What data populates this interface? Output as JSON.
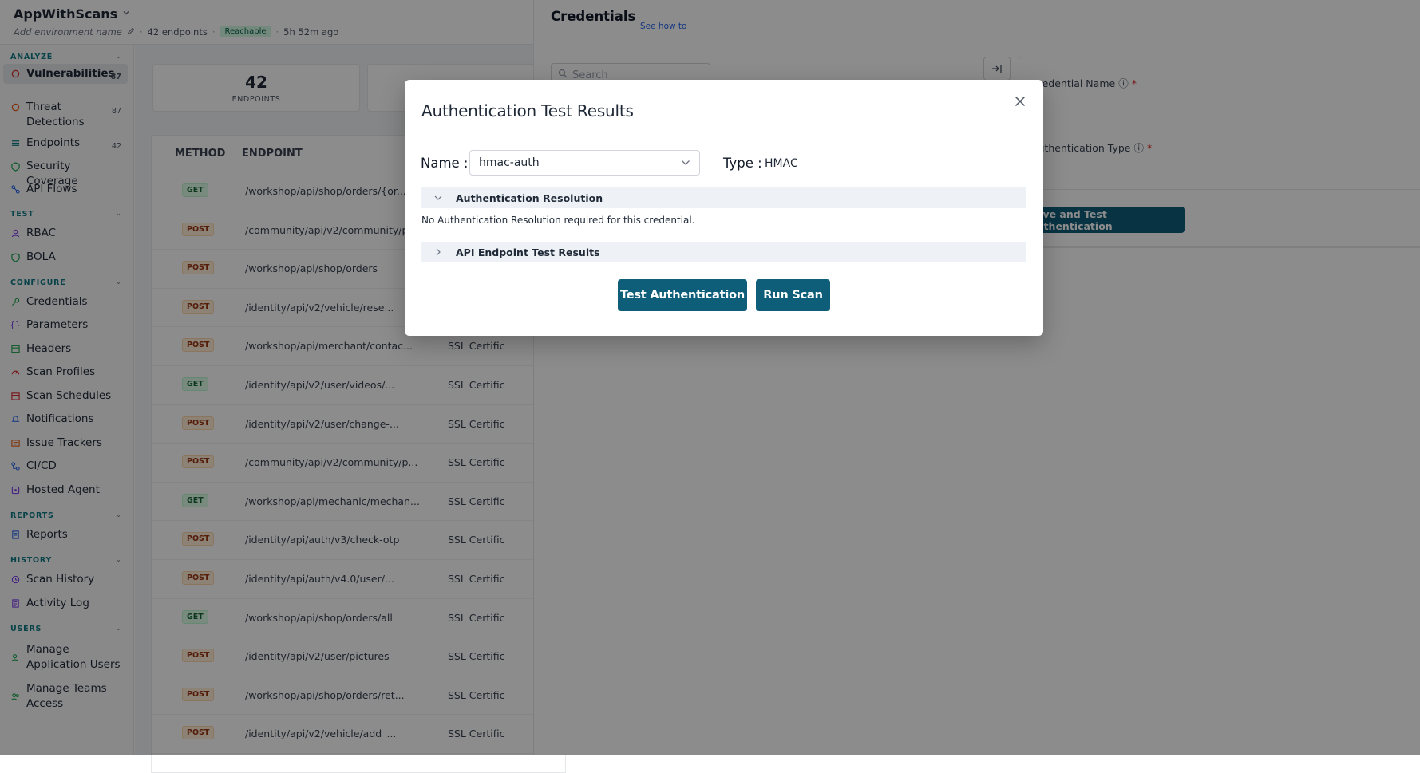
{
  "app": {
    "name": "AppWithScans",
    "env_placeholder": "Add environment name",
    "endpoint_count_text": "42 endpoints",
    "reachable_badge": "Reachable",
    "last_seen": "5h 52m ago"
  },
  "sidebar": {
    "sections": [
      {
        "title": "ANALYZE",
        "items": [
          {
            "label": "Vulnerabilities",
            "count": "87",
            "icon": "shield-alert-icon",
            "active": true
          },
          {
            "label": "Threat Detections",
            "count": "87",
            "icon": "threat-icon"
          },
          {
            "label": "Endpoints",
            "count": "42",
            "icon": "endpoints-icon"
          },
          {
            "label": "Security Coverage",
            "icon": "coverage-icon"
          },
          {
            "label": "API Flows",
            "icon": "flows-icon"
          }
        ]
      },
      {
        "title": "TEST",
        "items": [
          {
            "label": "RBAC",
            "icon": "rbac-icon"
          },
          {
            "label": "BOLA",
            "icon": "bola-icon"
          }
        ]
      },
      {
        "title": "CONFIGURE",
        "items": [
          {
            "label": "Credentials",
            "icon": "key-icon"
          },
          {
            "label": "Parameters",
            "icon": "braces-icon"
          },
          {
            "label": "Headers",
            "icon": "headers-icon"
          },
          {
            "label": "Scan Profiles",
            "icon": "gauge-icon"
          },
          {
            "label": "Scan Schedules",
            "icon": "calendar-icon"
          },
          {
            "label": "Notifications",
            "icon": "bell-icon"
          },
          {
            "label": "Issue Trackers",
            "icon": "tracker-icon"
          },
          {
            "label": "CI/CD",
            "icon": "cicd-icon"
          },
          {
            "label": "Hosted Agent",
            "icon": "agent-icon"
          }
        ]
      },
      {
        "title": "REPORTS",
        "items": [
          {
            "label": "Reports",
            "icon": "report-icon"
          }
        ]
      },
      {
        "title": "HISTORY",
        "items": [
          {
            "label": "Scan History",
            "icon": "history-icon"
          },
          {
            "label": "Activity Log",
            "icon": "log-icon"
          }
        ]
      },
      {
        "title": "USERS",
        "items": [
          {
            "label": "Manage Application Users",
            "icon": "users-icon"
          },
          {
            "label": "Manage Teams Access",
            "icon": "team-icon"
          }
        ]
      }
    ]
  },
  "stats": {
    "endpoints_value": "42",
    "endpoints_label": "ENDPOINTS"
  },
  "table": {
    "headers": {
      "method": "METHOD",
      "endpoint": "ENDPOINT"
    },
    "rows": [
      {
        "method": "GET",
        "endpoint": "/workshop/api/shop/orders/{or...",
        "vuln": ""
      },
      {
        "method": "POST",
        "endpoint": "/community/api/v2/community/p...",
        "vuln": ""
      },
      {
        "method": "POST",
        "endpoint": "/workshop/api/shop/orders",
        "vuln": ""
      },
      {
        "method": "POST",
        "endpoint": "/identity/api/v2/vehicle/rese...",
        "vuln": ""
      },
      {
        "method": "POST",
        "endpoint": "/workshop/api/merchant/contac...",
        "vuln": "SSL Certific"
      },
      {
        "method": "GET",
        "endpoint": "/identity/api/v2/user/videos/...",
        "vuln": "SSL Certific"
      },
      {
        "method": "POST",
        "endpoint": "/identity/api/v2/user/change-...",
        "vuln": "SSL Certific"
      },
      {
        "method": "POST",
        "endpoint": "/community/api/v2/community/p...",
        "vuln": "SSL Certific"
      },
      {
        "method": "GET",
        "endpoint": "/workshop/api/mechanic/mechan...",
        "vuln": "SSL Certific"
      },
      {
        "method": "POST",
        "endpoint": "/identity/api/auth/v3/check-otp",
        "vuln": "SSL Certific"
      },
      {
        "method": "POST",
        "endpoint": "/identity/api/auth/v4.0/user/...",
        "vuln": "SSL Certific"
      },
      {
        "method": "GET",
        "endpoint": "/workshop/api/shop/orders/all",
        "vuln": "SSL Certific"
      },
      {
        "method": "POST",
        "endpoint": "/identity/api/v2/user/pictures",
        "vuln": "SSL Certific"
      },
      {
        "method": "POST",
        "endpoint": "/workshop/api/shop/orders/ret...",
        "vuln": "SSL Certific"
      },
      {
        "method": "POST",
        "endpoint": "/identity/api/v2/vehicle/add_...",
        "vuln": "SSL Certific"
      }
    ]
  },
  "panel": {
    "title": "Credentials",
    "see_how": "See how to",
    "search_placeholder": "Search",
    "credential_name_label": "Credential Name",
    "auth_type_label": "Authentication Type",
    "save_button": "Save and Test Authentication"
  },
  "modal": {
    "title": "Authentication Test Results",
    "name_label": "Name :",
    "name_value": "hmac-auth",
    "type_label": "Type :",
    "type_value": "HMAC",
    "auth_resolution_title": "Authentication Resolution",
    "auth_resolution_text": "No Authentication Resolution required for this credential.",
    "api_test_results_title": "API Endpoint Test Results",
    "test_auth_button": "Test Authentication",
    "run_scan_button": "Run Scan"
  },
  "colors": {
    "primary": "#0e5e7a",
    "accent": "#0f7a86",
    "overlay": "rgba(0,0,0,0.45)"
  }
}
